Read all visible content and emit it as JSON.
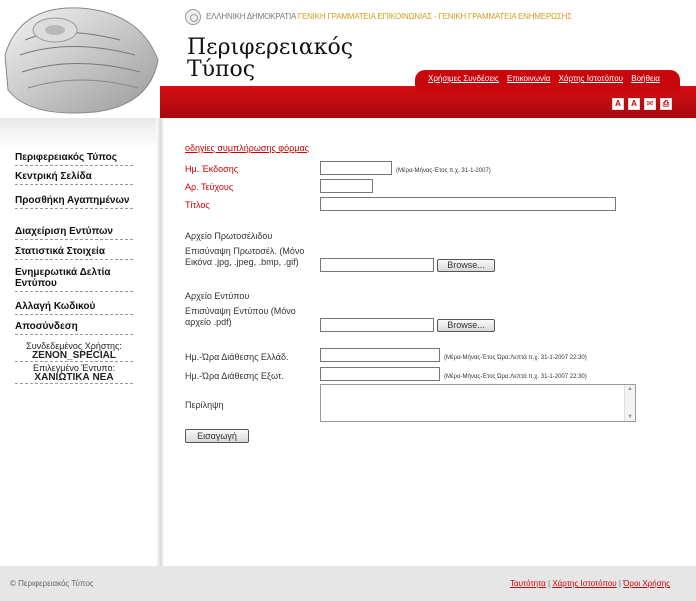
{
  "header": {
    "gov_ministry": "ΕΛΛΗΝΙΚΗ ΔΗΜΟΚΡΑΤΙΑ",
    "gov_secretariats": "ΓΕΝΙΚΗ ΓΡΑΜΜΑΤΕΙΑ ΕΠΙΚΟΙΝΩΝΙΑΣ - ΓΕΝΙΚΗ ΓΡΑΜΜΑΤΕΙΑ ΕΝΗΜΕΡΩΣΗΣ",
    "title_line1": "Περιφερειακός",
    "title_line2": "Τύπος",
    "top_links": [
      "Χρήσιμες Συνδέσεις",
      "Επικοινωνία",
      "Χάρτης Ιστοτόπου",
      "Βοήθεια"
    ],
    "icons": [
      "font-decrease-icon",
      "font-increase-icon",
      "email-icon",
      "print-icon"
    ],
    "colors": {
      "brand_red": "#c8070c"
    }
  },
  "sidebar": {
    "items": [
      "Περιφερειακός Τύπος",
      "Κεντρική Σελίδα",
      "Προσθήκη Αγαπημένων",
      "Διαχείριση Εντύπων",
      "Στατιστικά Στοιχεία",
      "Ενημερωτικά Δελτία Εντύπου",
      "Αλλαγή Κωδικού",
      "Αποσύνδεση"
    ],
    "user_label": "Συνδεδεμένος Χρήστης:",
    "user_name": "ZENON_SPECIAL",
    "selected_label": "Επιλεγμένο Έντυπο:",
    "selected_name": "ΧΑΝΙΩΤΙΚΑ ΝΕΑ"
  },
  "form": {
    "help_link": "οδηγίες συμπλήρωσης φόρμας",
    "issue_date_label": "Ημ. Έκδοσης",
    "issue_date_hint": "(Μέρα-Μήνας-Έτος π.χ. 31-1-2007)",
    "issue_no_label": "Αρ. Τεύχους",
    "title_label": "Τίτλος",
    "frontpage_section": "Αρχείο Πρωτοσέλιδου",
    "frontpage_attach_label": "Επισύναψη Πρωτοσέλ. (Μόνο Εικόνα .jpg, .jpeg, .bmp, .gif)",
    "browse_label": "Browse...",
    "file_section": "Αρχείο Εντύπου",
    "file_attach_label": "Επισύναψη Εντύπου (Μόνο αρχείο .pdf)",
    "greece_time_label": "Ημ.-Ώρα Διάθεσης Ελλάδ.",
    "abroad_time_label": "Ημ.-Ώρα Διάθεσης Εξωτ.",
    "datetime_hint": "(Μέρα-Μήνας-Έτος Ώρα:Λεπτά π.χ. 31-1-2007 22:30)",
    "summary_label": "Περίληψη",
    "submit_label": "Εισαγωγή"
  },
  "footer": {
    "copyright": "© Περιφερειακός Τύπος",
    "links": [
      "Ταυτότητα",
      "Χάρτης Ιστοτόπου",
      "Όροι Χρήσης"
    ],
    "separator": " | "
  }
}
